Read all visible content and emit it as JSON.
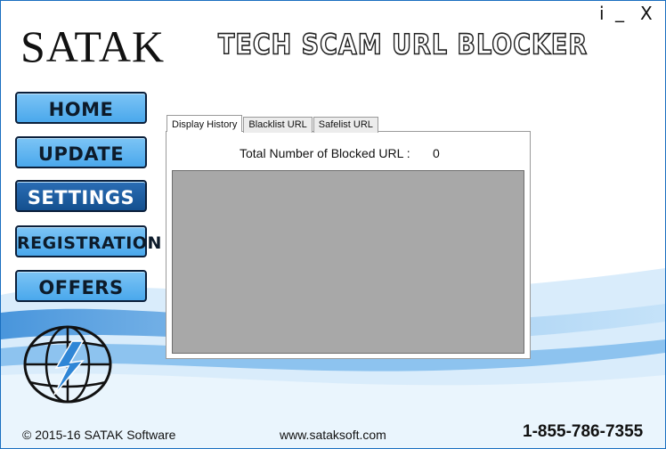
{
  "header": {
    "brand": "SATAK",
    "app_title": "TECH SCAM URL BLOCKER",
    "controls": {
      "info": "i",
      "minimize": "_",
      "close": "X"
    }
  },
  "nav": {
    "items": [
      {
        "label": "HOME",
        "active": false
      },
      {
        "label": "UPDATE",
        "active": false
      },
      {
        "label": "SETTINGS",
        "active": true
      },
      {
        "label": "REGISTRATION",
        "active": false
      },
      {
        "label": "OFFERS",
        "active": false
      }
    ]
  },
  "main": {
    "tabs": [
      {
        "label": "Display History",
        "active": true
      },
      {
        "label": "Blacklist URL",
        "active": false
      },
      {
        "label": "Safelist URL",
        "active": false
      }
    ],
    "total_label": "Total Number of Blocked URL :",
    "total_value": "0"
  },
  "footer": {
    "copyright": "© 2015-16 SATAK Software",
    "url": "www.sataksoft.com",
    "phone": "1-855-786-7355"
  },
  "colors": {
    "accent": "#4aa8ec",
    "active_nav": "#1a5fa6",
    "list_bg": "#a8a8a8"
  }
}
